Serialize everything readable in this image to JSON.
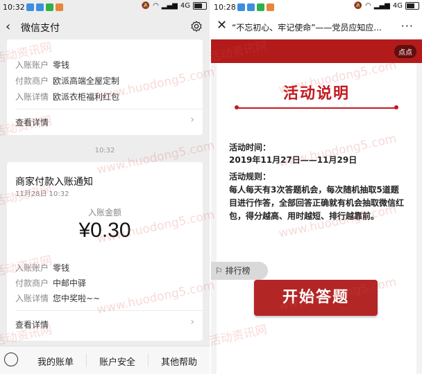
{
  "left": {
    "status": {
      "time": "10:32",
      "network": "4G"
    },
    "nav": {
      "back_icon": "chevron-left-icon",
      "title": "微信支付",
      "settings_icon": "gear-icon"
    },
    "card1": {
      "rows": [
        {
          "label": "入账账户",
          "value": "零钱"
        },
        {
          "label": "付款商户",
          "value": "欧派高端全屋定制"
        },
        {
          "label": "入账详情",
          "value": "欧派衣柜福利红包"
        }
      ],
      "detail": "查看详情"
    },
    "timestamp": "10:32",
    "card2": {
      "title": "商家付款入账通知",
      "date": "11月28日",
      "time": "10:32",
      "amount_label": "入账金额",
      "amount": "¥0.30",
      "rows": [
        {
          "label": "入账账户",
          "value": "零钱"
        },
        {
          "label": "付款商户",
          "value": "中邮中驿"
        },
        {
          "label": "入账详情",
          "value": "您中奖啦~~"
        }
      ],
      "detail": "查看详情"
    },
    "bottom": {
      "keyboard_icon": "keyboard-icon",
      "buttons": [
        "我的账单",
        "账户安全",
        "其他帮助"
      ]
    }
  },
  "right": {
    "status": {
      "time": "10:28",
      "network": "4G"
    },
    "nav": {
      "close_icon": "close-icon",
      "title": "“不忘初心、牢记使命”——党员应知应...",
      "more_icon": "more-icon"
    },
    "pill": "点点",
    "activity": {
      "title": "活动说明",
      "time_label": "活动时间：",
      "time_value": "2019年11月27日——11月29日",
      "rules_label": "活动规则：",
      "rules_text": "每人每天有3次答题机会，每次随机抽取5道题目进行作答，全部回答正确就有机会抽取微信红包，得分越高、用时越短、排行越靠前。",
      "rank_button": "排行榜",
      "start_button": "开始答题"
    }
  },
  "watermark": {
    "text_cn": "活动资讯网",
    "text_url": "www.huodong5.com"
  },
  "colors": {
    "accent_red": "#c4181e",
    "banner_red": "#b31b1b",
    "button_red": "#b32626"
  }
}
